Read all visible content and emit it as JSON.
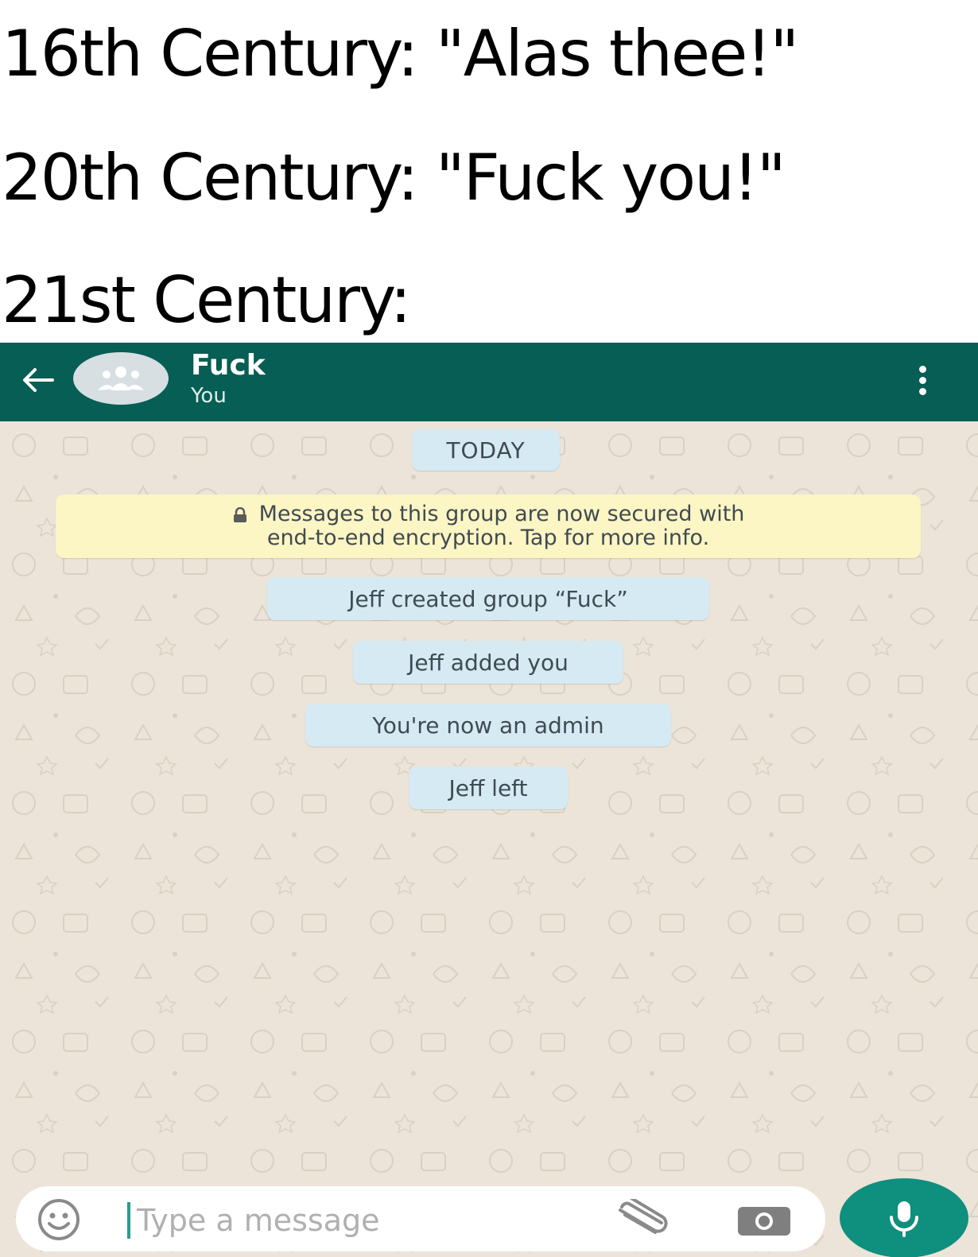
{
  "captions": {
    "line1": "16th Century: \"Alas thee!\"",
    "line2": "20th Century: \"Fuck you!\"",
    "line3": "21st Century:"
  },
  "header": {
    "title": "Fuck",
    "subtitle": "You",
    "color": "#075e54"
  },
  "chat": {
    "date_chip": "TODAY",
    "encryption_notice_line1": "Messages to this group are now secured with",
    "encryption_notice_line2": "end-to-end encryption. Tap for more info.",
    "events": [
      "Jeff created group “Fuck”",
      "Jeff added you",
      "You're now an admin",
      "Jeff left"
    ]
  },
  "composer": {
    "placeholder": "Type a message",
    "accent": "#0f8f7e"
  },
  "icons": [
    "back-arrow-icon",
    "group-avatar-icon",
    "more-vertical-icon",
    "lock-icon",
    "emoji-icon",
    "attach-icon",
    "camera-icon",
    "mic-icon"
  ]
}
